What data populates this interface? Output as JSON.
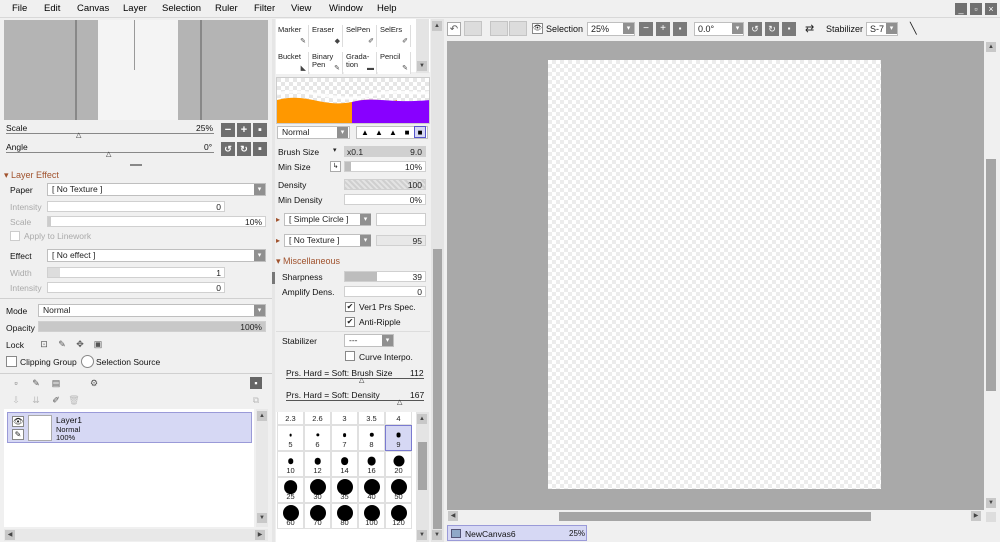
{
  "menu": [
    "File",
    "Edit",
    "Canvas",
    "Layer",
    "Selection",
    "Ruler",
    "Filter",
    "View",
    "Window",
    "Help"
  ],
  "window_buttons": [
    "_",
    "▫",
    "×"
  ],
  "navigator": {
    "scale_label": "Scale",
    "scale_value": "25%",
    "angle_label": "Angle",
    "angle_value": "0°"
  },
  "layer_effect": {
    "header": "Layer Effect",
    "paper_label": "Paper",
    "paper_value": "[ No Texture ]",
    "intensity_label": "Intensity",
    "intensity_value": "0",
    "scale_label": "Scale",
    "scale_value": "10%",
    "apply_linework": "Apply to Linework",
    "effect_label": "Effect",
    "effect_value": "[ No effect ]",
    "width_label": "Width",
    "width_value": "1",
    "intensity2_label": "Intensity",
    "intensity2_value": "0"
  },
  "layer_props": {
    "mode_label": "Mode",
    "mode_value": "Normal",
    "opacity_label": "Opacity",
    "opacity_value": "100%",
    "opacity_level": 1.0,
    "lock_label": "Lock",
    "clipping_group": "Clipping Group",
    "selection_source": "Selection Source"
  },
  "layers": [
    {
      "name": "Layer1",
      "mode": "Normal",
      "opacity": "100%"
    }
  ],
  "tools": [
    {
      "label": "Marker",
      "icon": "✎"
    },
    {
      "label": "Eraser",
      "icon": "◆"
    },
    {
      "label": "SelPen",
      "icon": "✐"
    },
    {
      "label": "SelErs",
      "icon": "✐"
    },
    {
      "label": "Bucket",
      "icon": "◣"
    },
    {
      "label": "Binary Pen",
      "icon": "✎"
    },
    {
      "label": "Grada-tion",
      "icon": "▬"
    },
    {
      "label": "Pencil",
      "icon": "✎"
    }
  ],
  "brush": {
    "blend_mode": "Normal",
    "size_label": "Brush Size",
    "size_mult": "x0.1",
    "size_value": "9.0",
    "min_size_label": "Min Size",
    "min_size_value": "10%",
    "density_label": "Density",
    "density_value": "100",
    "min_density_label": "Min Density",
    "min_density_value": "0%",
    "shape": "[ Simple Circle ]",
    "texture": "[ No Texture ]",
    "texture_value": "95",
    "misc_header": "Miscellaneous",
    "sharpness_label": "Sharpness",
    "sharpness_value": "39",
    "amplify_label": "Amplify Dens.",
    "amplify_value": "0",
    "ver1": "Ver1 Prs Spec.",
    "anti_ripple": "Anti-Ripple",
    "stabilizer_label": "Stabilizer",
    "stabilizer_value": "---",
    "curve_interp": "Curve Interpo.",
    "prs_size_label": "Prs. Hard = Soft: Brush Size",
    "prs_size_value": "112",
    "prs_density_label": "Prs. Hard = Soft: Density",
    "prs_density_value": "167"
  },
  "brush_sizes": {
    "row0": [
      "2.3",
      "2.6",
      "3",
      "3.5",
      "4"
    ],
    "sizes": [
      "5",
      "6",
      "7",
      "8",
      "9",
      "10",
      "12",
      "14",
      "16",
      "20",
      "25",
      "30",
      "35",
      "40",
      "50",
      "60",
      "70",
      "80",
      "100",
      "120"
    ],
    "selected": "9"
  },
  "toolbar": {
    "selection_label": "Selection",
    "zoom_value": "25%",
    "angle_value": "0.0°",
    "stabilizer_label": "Stabilizer",
    "stabilizer_value": "S-7"
  },
  "document_tab": {
    "name": "NewCanvas6",
    "zoom": "25%"
  },
  "colors": {
    "accent_orange": "#ff9800",
    "accent_purple": "#8800ff",
    "section_brown": "#a0522d",
    "selection_blue": "#d6d8f4"
  }
}
